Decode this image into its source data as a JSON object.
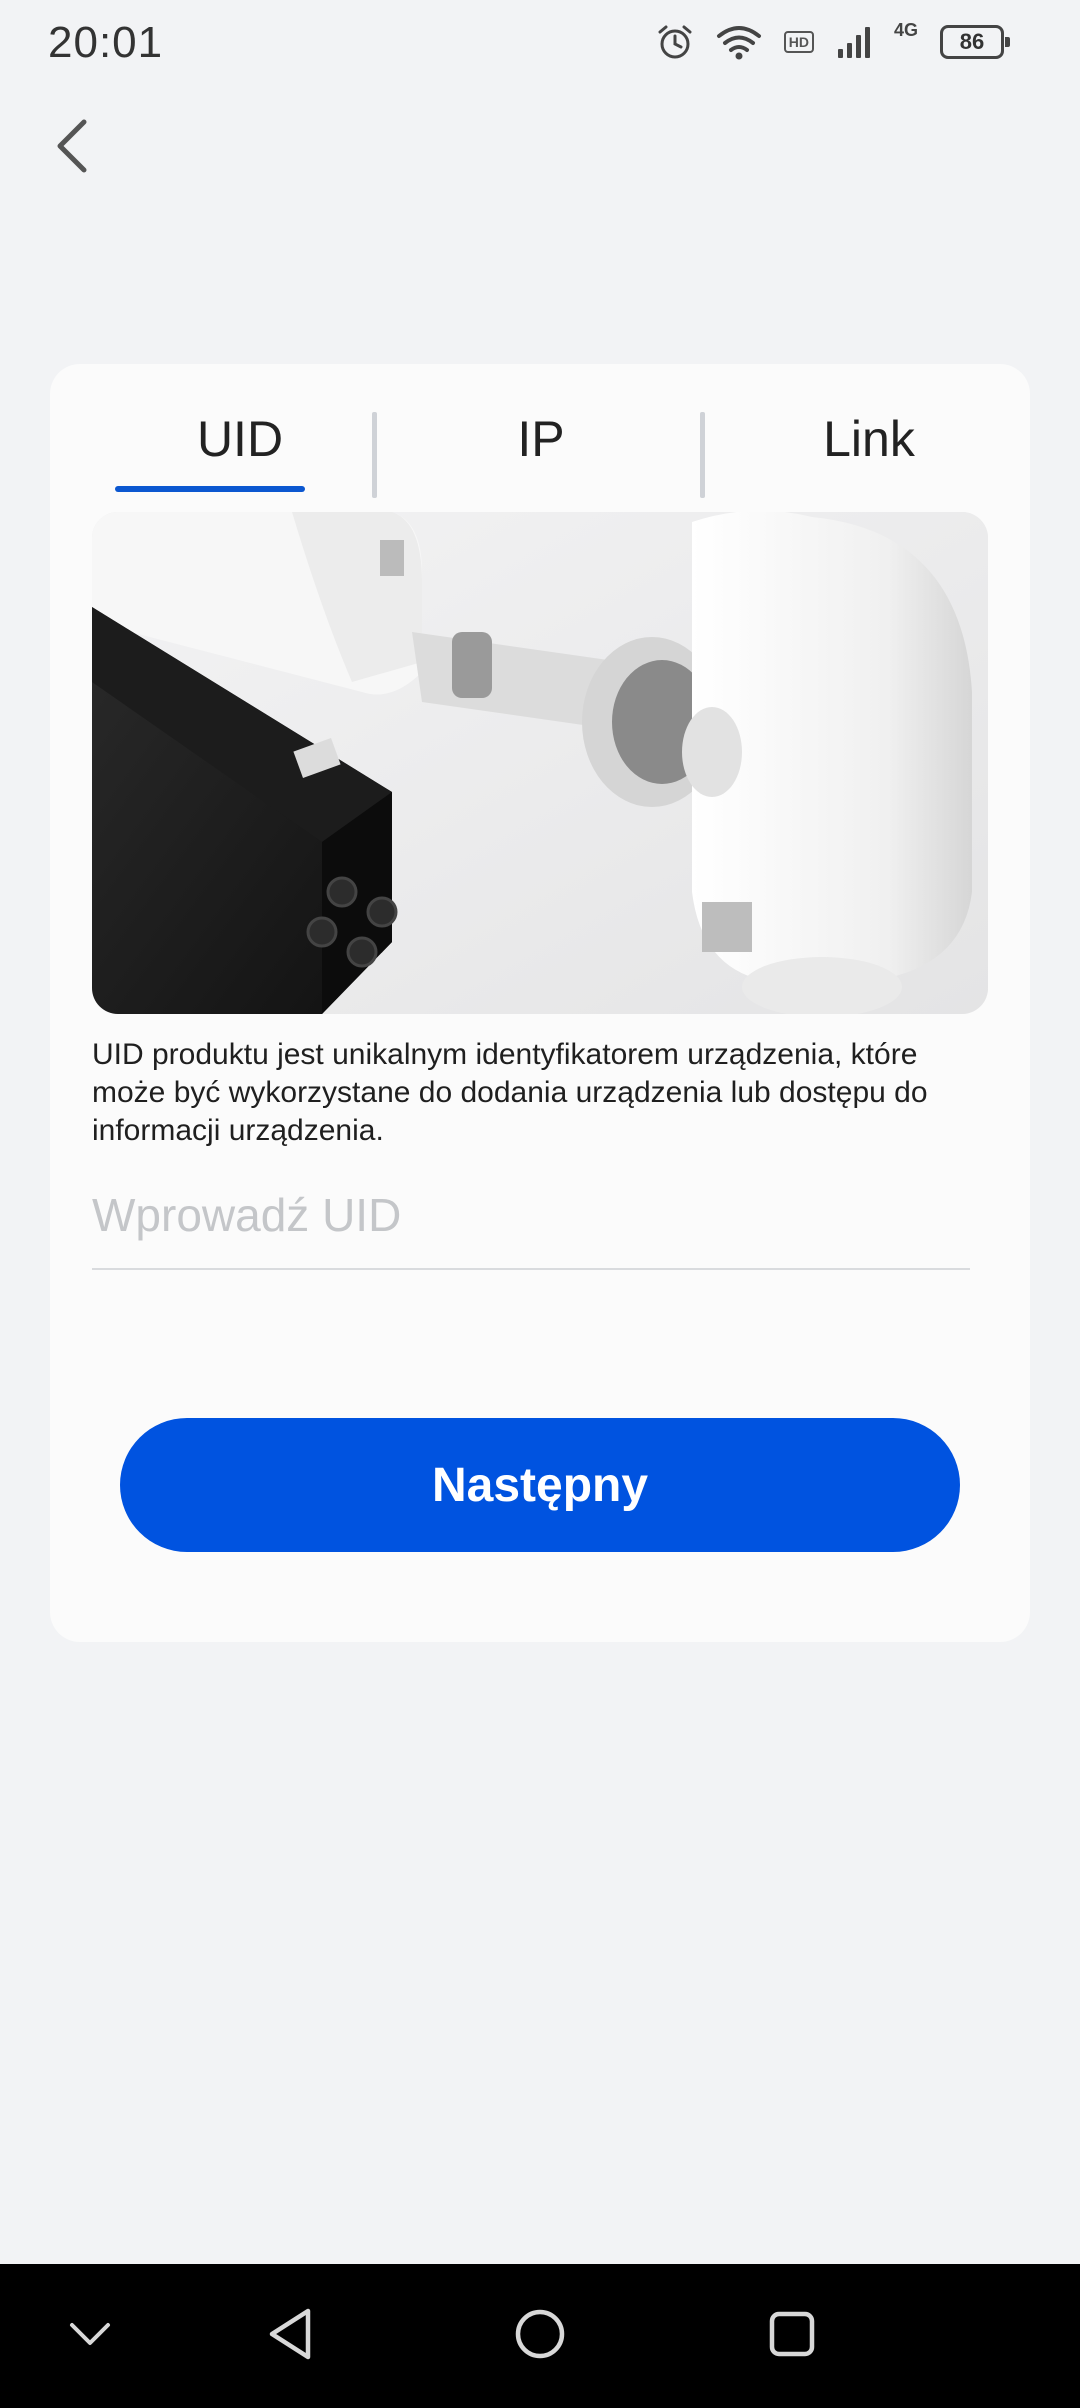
{
  "status_bar": {
    "time": "20:01",
    "network": "4G",
    "hd": "HD",
    "battery": "86",
    "icons": [
      "alarm-icon",
      "wifi-icon",
      "hd-icon",
      "signal-icon",
      "battery-icon"
    ]
  },
  "header": {
    "back_icon": "chevron-left-icon"
  },
  "tabs": [
    {
      "label": "UID",
      "selected": true
    },
    {
      "label": "IP",
      "selected": false
    },
    {
      "label": "Link",
      "selected": false
    }
  ],
  "main": {
    "description": "UID produktu jest unikalnym identyfikatorem urządzenia, które może być wykorzystane do dodania urządzenia lub dostępu do informacji urządzenia.",
    "uid_input": {
      "value": "",
      "placeholder": "Wprowadź UID"
    },
    "next_button": "Następny"
  },
  "nav_bar": {
    "items": [
      "chevron-down-icon",
      "triangle-back-icon",
      "circle-home-icon",
      "square-recents-icon"
    ]
  },
  "colors": {
    "accent": "#0053e0",
    "background": "#f2f3f5",
    "card": "#fbfbfb"
  }
}
